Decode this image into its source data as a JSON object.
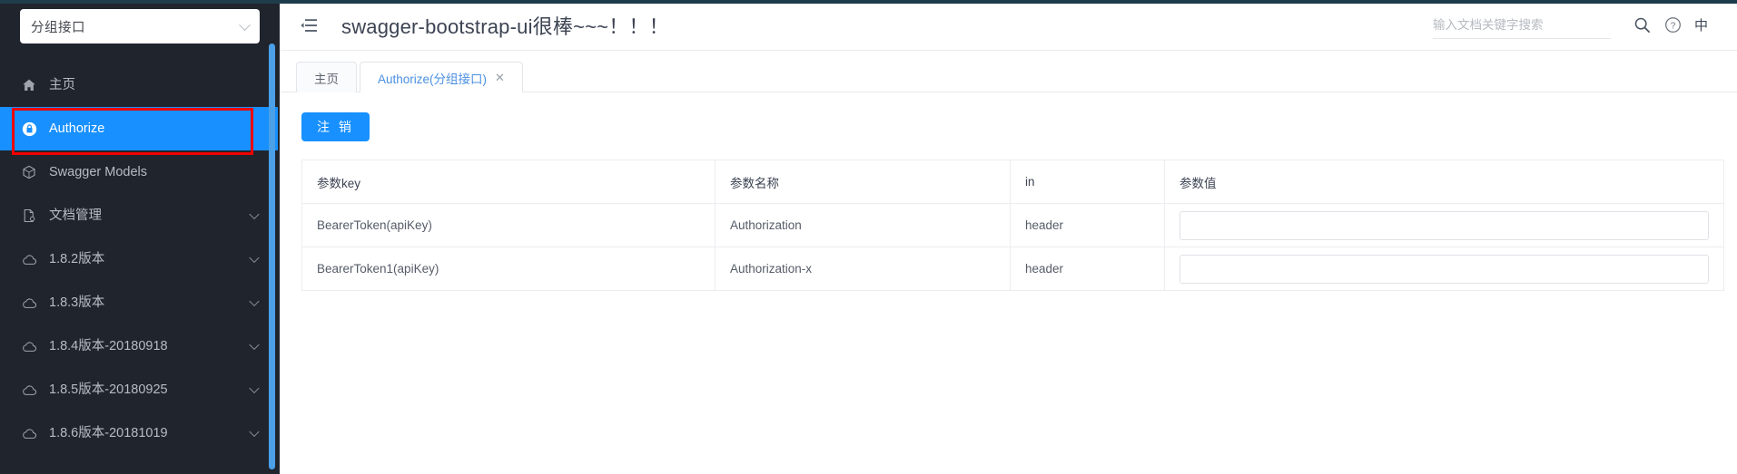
{
  "sidebar": {
    "group_select": {
      "value": "分组接口",
      "icon": "chevron-down-icon"
    },
    "items": [
      {
        "label": "主页",
        "icon": "home-icon",
        "active": false,
        "caret": false
      },
      {
        "label": "Authorize",
        "icon": "lock-icon",
        "active": true,
        "caret": false
      },
      {
        "label": "Swagger Models",
        "icon": "cube-icon",
        "active": false,
        "caret": false
      },
      {
        "label": "文档管理",
        "icon": "document-icon",
        "active": false,
        "caret": true
      },
      {
        "label": "1.8.2版本",
        "icon": "cloud-icon",
        "active": false,
        "caret": true
      },
      {
        "label": "1.8.3版本",
        "icon": "cloud-icon",
        "active": false,
        "caret": true
      },
      {
        "label": "1.8.4版本-20180918",
        "icon": "cloud-icon",
        "active": false,
        "caret": true
      },
      {
        "label": "1.8.5版本-20180925",
        "icon": "cloud-icon",
        "active": false,
        "caret": true
      },
      {
        "label": "1.8.6版本-20181019",
        "icon": "cloud-icon",
        "active": false,
        "caret": true
      }
    ]
  },
  "header": {
    "fold_icon": "menu-fold-icon",
    "title": "swagger-bootstrap-ui很棒~~~！！！",
    "search": {
      "value": "",
      "placeholder": "输入文档关键字搜索",
      "icon": "search-icon"
    },
    "help_icon": "question-circle-icon",
    "language_label": "中"
  },
  "tabs": [
    {
      "label": "主页",
      "active": false,
      "closable": false,
      "close_label": ""
    },
    {
      "label": "Authorize(分组接口)",
      "active": true,
      "closable": true,
      "close_label": "✕"
    }
  ],
  "content": {
    "logout_button": "注 销",
    "table": {
      "headers": [
        "参数key",
        "参数名称",
        "in",
        "参数值"
      ],
      "rows": [
        {
          "key": "BearerToken(apiKey)",
          "name": "Authorization",
          "in": "header",
          "value": ""
        },
        {
          "key": "BearerToken1(apiKey)",
          "name": "Authorization-x",
          "in": "header",
          "value": ""
        }
      ]
    }
  },
  "colors": {
    "sidebar_bg": "#20242d",
    "accent": "#1890ff",
    "annotation": "#ee0000",
    "top_rule": "#1e3d4a",
    "tab_active_text": "#4a90e2"
  }
}
